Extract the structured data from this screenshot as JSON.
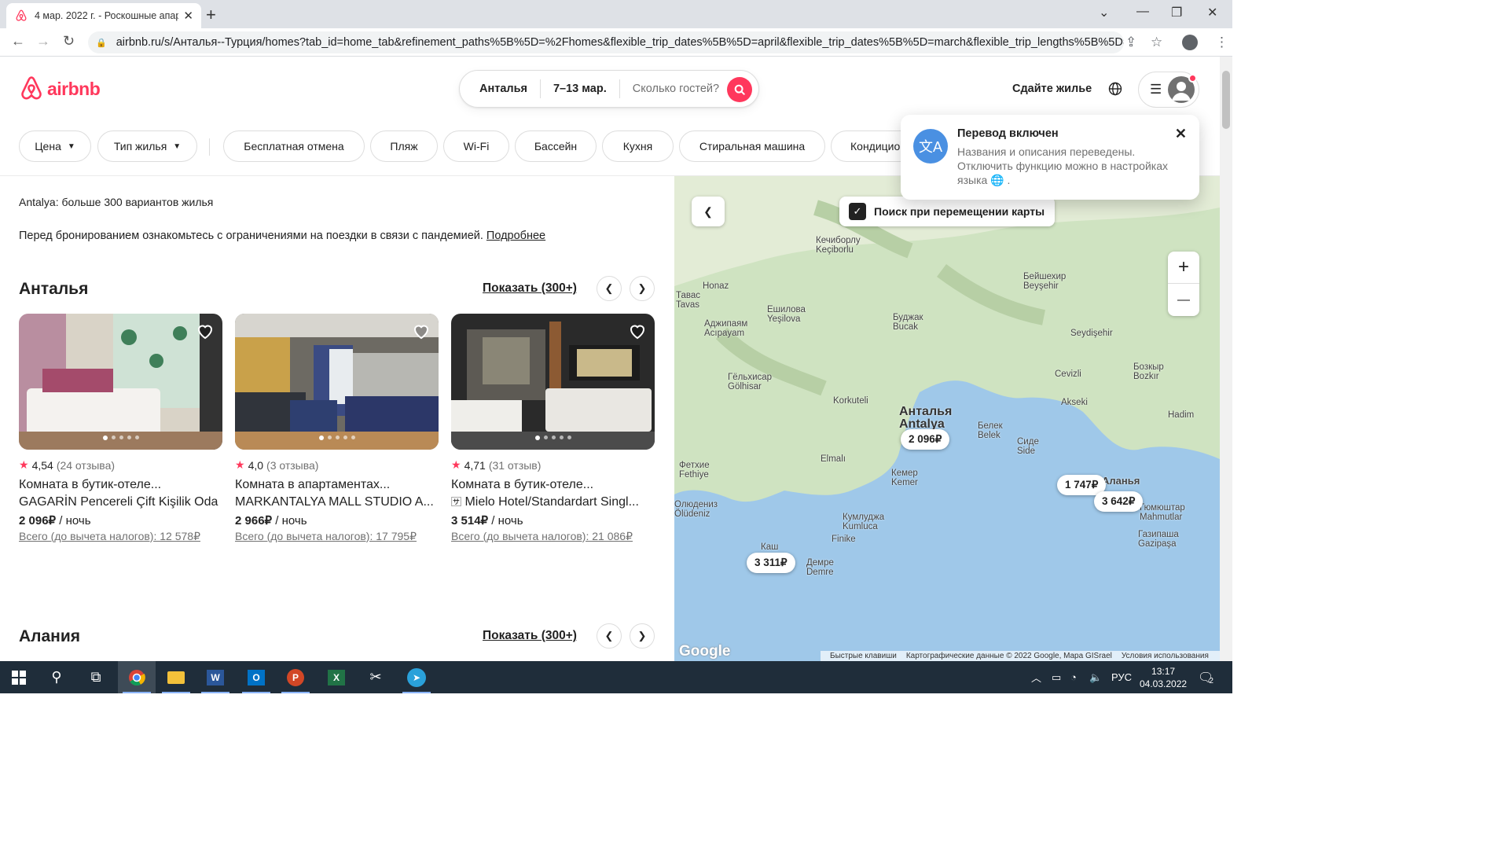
{
  "browser": {
    "tab_title": "4 мар. 2022 г. - Роскошные апар",
    "url": "airbnb.ru/s/Анталья--Турция/homes?tab_id=home_tab&refinement_paths%5B%5D=%2Fhomes&flexible_trip_dates%5B%5D=april&flexible_trip_dates%5B%5D=march&flexible_trip_lengths%5B%5D=...",
    "new_tab": "+"
  },
  "header": {
    "logo_text": "airbnb",
    "search": {
      "location": "Анталья",
      "dates": "7–13 мар.",
      "guests": "Сколько гостей?"
    },
    "host_link": "Сдайте жилье"
  },
  "filters": {
    "items": [
      "Цена",
      "Тип жилья",
      "Бесплатная отмена",
      "Пляж",
      "Wi-Fi",
      "Бассейн",
      "Кухня",
      "Стиральная машина",
      "Кондиционер"
    ]
  },
  "toast": {
    "title": "Перевод включен",
    "body": "Названия и описания переведены. Отключить функцию можно в настройках языка",
    "close": "✕"
  },
  "results": {
    "count": "Antalya: больше 300 вариантов жилья",
    "notice": "Перед бронированием ознакомьтесь с ограничениями на поездки в связи с пандемией.",
    "notice_link": "Подробнее"
  },
  "sections": [
    {
      "title": "Анталья",
      "show_all": "Показать (300+)"
    },
    {
      "title": "Алания",
      "show_all": "Показать (300+)"
    }
  ],
  "listings": [
    {
      "rating": "4,54",
      "reviews": "(24 отзыва)",
      "title": "Комната в бутик-отеле...",
      "name": "GAGARİN Pencereli Çift Kişilik Oda",
      "price": "2 096₽",
      "per": " / ночь",
      "total": "Всего (до вычета налогов): 12 578₽"
    },
    {
      "rating": "4,0",
      "reviews": "(3 отзыва)",
      "title": "Комната в апартаментах...",
      "name": "MARKANTALYA MALL STUDIO A...",
      "price": "2 966₽",
      "per": " / ночь",
      "total": "Всего (до вычета налогов): 17 795₽"
    },
    {
      "rating": "4,71",
      "reviews": "(31 отзыв)",
      "title": "Комната в бутик-отеле...",
      "name": "Mielo Hotel/Standardart Singl...",
      "price": "3 514₽",
      "per": " / ночь",
      "total": "Всего (до вычета налогов): 21 086₽"
    }
  ],
  "map": {
    "search_on_move": "Поиск при перемещении карты",
    "zoom_in": "+",
    "zoom_out": "—",
    "prices": [
      "2 096₽",
      "1 747₽",
      "3 642₽",
      "3 311₽"
    ],
    "labels": [
      {
        "t": "Кечиборлу\nKeçiborlu"
      },
      {
        "t": "Тавас\nTavas"
      },
      {
        "t": "Honaz"
      },
      {
        "t": "Ешилова\nYeşilova"
      },
      {
        "t": "Буджак\nBucak"
      },
      {
        "t": "Бейшехир\nBeyşehir"
      },
      {
        "t": "Аджипаям\nAcıpayam"
      },
      {
        "t": "Seydişehir"
      },
      {
        "t": "Гёльхисар\nGölhisar"
      },
      {
        "t": "Cevizli"
      },
      {
        "t": "Бозкыр\nBozkır"
      },
      {
        "t": "Korkuteli"
      },
      {
        "t": "Akseki"
      },
      {
        "t": "Hadim"
      },
      {
        "t": "Анталья\nAntalya"
      },
      {
        "t": "Белек\nBelek"
      },
      {
        "t": "Сиде\nSide"
      },
      {
        "t": "Elmalı"
      },
      {
        "t": "Фетхие\nFethiye"
      },
      {
        "t": "Кемер\nKemer"
      },
      {
        "t": "Аланья"
      },
      {
        "t": "Олюдениз\nÖlüdeniz"
      },
      {
        "t": "Кумлуджа\nKumluca"
      },
      {
        "t": "Finike"
      },
      {
        "t": "Гюмюштар\nMahmutlar"
      },
      {
        "t": "Газипаша\nGazipaşa"
      },
      {
        "t": "Каш"
      },
      {
        "t": "Демре\nDemre"
      }
    ],
    "google": "Google",
    "shortcuts": "Быстрые клавиши",
    "mapdata": "Картографические данные © 2022 Google, Mapa GISrael",
    "terms": "Условия использования"
  },
  "taskbar": {
    "lang": "РУС",
    "time": "13:17",
    "date": "04.03.2022",
    "notif_count": "2"
  },
  "colors": {
    "brand": "#ff385c",
    "water": "#9fc8e9",
    "land": "#cfe3c1"
  }
}
